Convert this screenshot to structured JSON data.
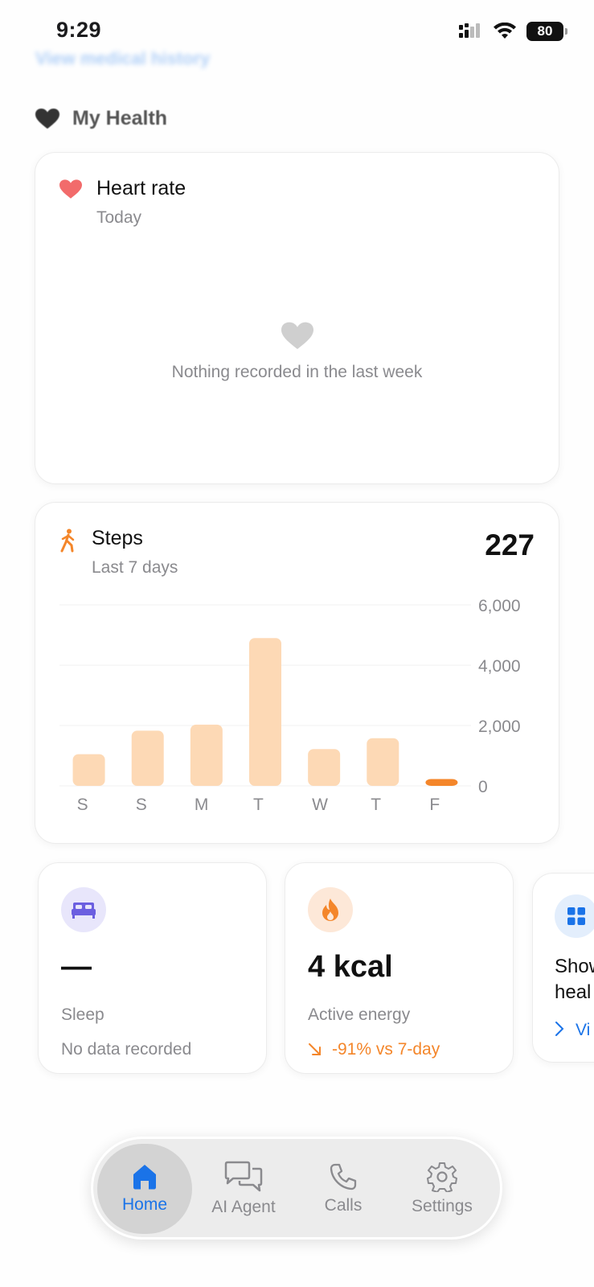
{
  "status_bar": {
    "time": "9:29",
    "battery": "80"
  },
  "header": {
    "view_history_link": "View medical history"
  },
  "section": {
    "title": "My Health"
  },
  "heart_card": {
    "title": "Heart rate",
    "subtitle": "Today",
    "empty_text": "Nothing recorded in the last week"
  },
  "steps_card": {
    "title": "Steps",
    "subtitle": "Last 7 days",
    "total": "227"
  },
  "chart_data": {
    "type": "bar",
    "categories": [
      "S",
      "S",
      "M",
      "T",
      "W",
      "T",
      "F"
    ],
    "values": [
      1050,
      1830,
      2030,
      4900,
      1220,
      1580,
      227
    ],
    "highlight_index": 6,
    "ylim": [
      0,
      6000
    ],
    "yticks": [
      "6,000",
      "4,000",
      "2,000",
      "0"
    ],
    "ytick_values": [
      6000,
      4000,
      2000,
      0
    ],
    "bar_color": "#fdd9b5",
    "highlight_color": "#f4862a",
    "grid": true
  },
  "sleep_card": {
    "value": "—",
    "name": "Sleep",
    "note": "No data recorded"
  },
  "energy_card": {
    "value": "4 kcal",
    "name": "Active energy",
    "trend": "-91% vs 7-day"
  },
  "more_card": {
    "line1": "Show",
    "line2": "heal",
    "link": "Vi"
  },
  "tab_bar": {
    "tabs": [
      {
        "label": "Home",
        "icon": "house-icon",
        "active": true
      },
      {
        "label": "AI Agent",
        "icon": "chat-bubbles-icon",
        "active": false
      },
      {
        "label": "Calls",
        "icon": "phone-icon",
        "active": false
      },
      {
        "label": "Settings",
        "icon": "gear-icon",
        "active": false
      }
    ]
  },
  "colors": {
    "accent_blue": "#1a73e8",
    "steps_orange": "#f4862a",
    "heart_red": "#f26b6b",
    "sleep_purple": "#6b5fe0"
  }
}
